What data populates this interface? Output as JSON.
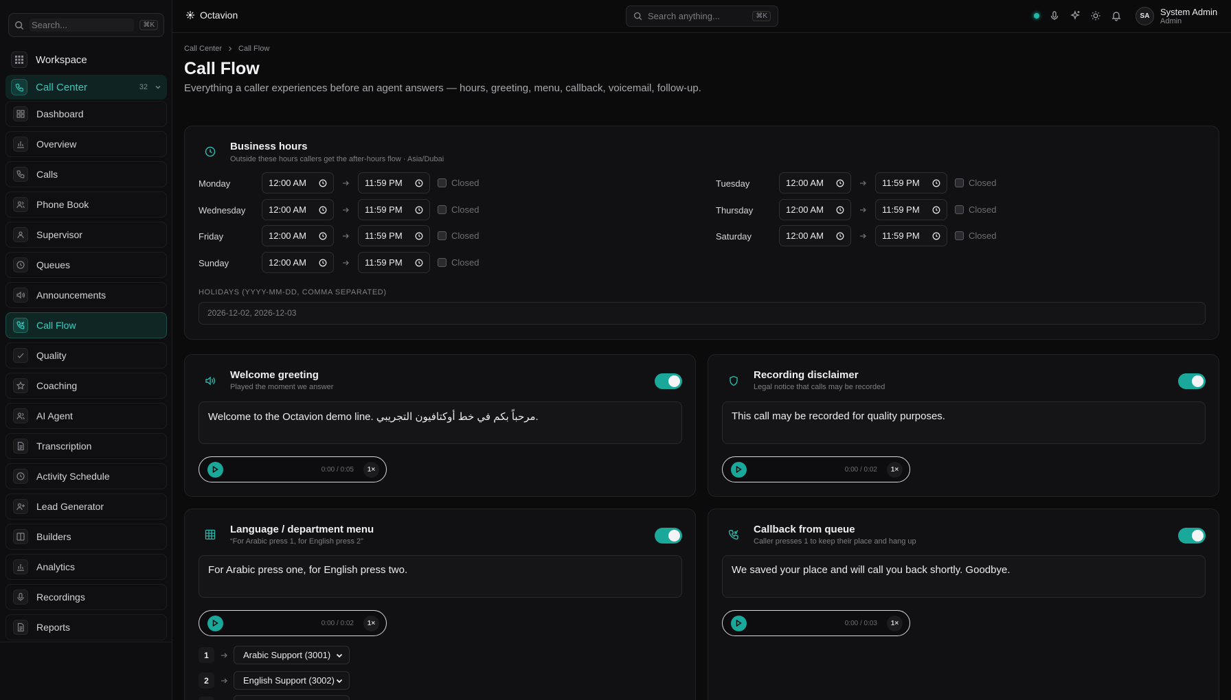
{
  "sidebar": {
    "search_placeholder": "Search...",
    "search_shortcut": "⌘K",
    "workspace_label": "Workspace",
    "group": {
      "label": "Call Center",
      "count": "32"
    },
    "items": [
      {
        "label": "Dashboard",
        "icon": "grid-icon"
      },
      {
        "label": "Overview",
        "icon": "bar-chart-icon"
      },
      {
        "label": "Calls",
        "icon": "phone-icon"
      },
      {
        "label": "Phone Book",
        "icon": "users-icon"
      },
      {
        "label": "Supervisor",
        "icon": "user-group-icon"
      },
      {
        "label": "Queues",
        "icon": "clock-icon"
      },
      {
        "label": "Announcements",
        "icon": "speaker-icon"
      },
      {
        "label": "Call Flow",
        "icon": "phone-flow-icon",
        "active": true
      },
      {
        "label": "Quality",
        "icon": "check-icon"
      },
      {
        "label": "Coaching",
        "icon": "star-icon"
      },
      {
        "label": "AI Agent",
        "icon": "users-icon"
      },
      {
        "label": "Transcription",
        "icon": "document-icon"
      },
      {
        "label": "Activity Schedule",
        "icon": "clock-icon"
      },
      {
        "label": "Lead Generator",
        "icon": "user-plus-icon"
      },
      {
        "label": "Builders",
        "icon": "columns-icon"
      },
      {
        "label": "Analytics",
        "icon": "bar-chart-icon"
      },
      {
        "label": "Recordings",
        "icon": "mic-icon"
      },
      {
        "label": "Reports",
        "icon": "document-icon"
      }
    ]
  },
  "topbar": {
    "brand": "Octavion",
    "search_placeholder": "Search anything...",
    "search_shortcut": "⌘K",
    "user": {
      "initials": "SA",
      "name": "System Admin",
      "role": "Admin"
    },
    "status_color": "#1fb8a8"
  },
  "page": {
    "breadcrumb": [
      "Call Center",
      "Call Flow"
    ],
    "title": "Call Flow",
    "subtitle": "Everything a caller experiences before an agent answers — hours, greeting, menu, callback, voicemail, follow-up."
  },
  "business_hours": {
    "title": "Business hours",
    "subtitle": "Outside these hours callers get the after-hours flow · Asia/Dubai",
    "closed_label": "Closed",
    "days": [
      {
        "day": "Monday",
        "open": "12:00 AM",
        "close": "11:59 PM",
        "closed": false
      },
      {
        "day": "Tuesday",
        "open": "12:00 AM",
        "close": "11:59 PM",
        "closed": false
      },
      {
        "day": "Wednesday",
        "open": "12:00 AM",
        "close": "11:59 PM",
        "closed": false
      },
      {
        "day": "Thursday",
        "open": "12:00 AM",
        "close": "11:59 PM",
        "closed": false
      },
      {
        "day": "Friday",
        "open": "12:00 AM",
        "close": "11:59 PM",
        "closed": false
      },
      {
        "day": "Saturday",
        "open": "12:00 AM",
        "close": "11:59 PM",
        "closed": false
      },
      {
        "day": "Sunday",
        "open": "12:00 AM",
        "close": "11:59 PM",
        "closed": false
      }
    ],
    "holidays_label": "HOLIDAYS (YYYY-MM-DD, COMMA SEPARATED)",
    "holidays_value": "2026-12-02, 2026-12-03"
  },
  "cards": {
    "welcome": {
      "title": "Welcome greeting",
      "subtitle": "Played the moment we answer",
      "enabled": true,
      "text": "Welcome to the Octavion demo line. مرحباً بكم في خط أوكتافيون التجريبي.",
      "time": "0:00 / 0:05",
      "speed": "1×"
    },
    "disclaimer": {
      "title": "Recording disclaimer",
      "subtitle": "Legal notice that calls may be recorded",
      "enabled": true,
      "text": "This call may be recorded for quality purposes.",
      "time": "0:00 / 0:02",
      "speed": "1×"
    },
    "menu": {
      "title": "Language / department menu",
      "subtitle": "“For Arabic press 1, for English press 2”",
      "enabled": true,
      "text": "For Arabic press one, for English press two.",
      "time": "0:00 / 0:02",
      "speed": "1×",
      "options": [
        {
          "key": "1",
          "target": "Arabic Support (3001)"
        },
        {
          "key": "2",
          "target": "English Support (3002)"
        }
      ]
    },
    "callback": {
      "title": "Callback from queue",
      "subtitle": "Caller presses 1 to keep their place and hang up",
      "enabled": true,
      "text": "We saved your place and will call you back shortly. Goodbye.",
      "time": "0:00 / 0:03",
      "speed": "1×"
    }
  },
  "colors": {
    "accent": "#1aa89a",
    "background": "#0b0b0c",
    "card": "#111113"
  }
}
